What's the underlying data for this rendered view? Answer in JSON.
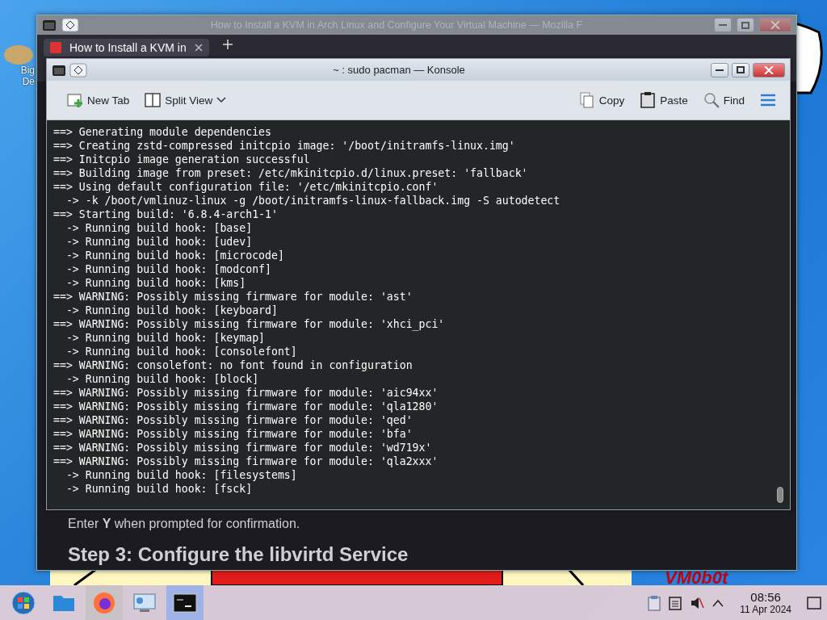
{
  "desktop": {
    "icon_label_lines": [
      "Big",
      "De"
    ],
    "wallpaper_texts": [
      "VM0b0t"
    ]
  },
  "browser_window": {
    "title": "How to Install a KVM in Arch Linux and Configure Your Virtual Machine — Mozilla F",
    "tabs": [
      {
        "label": "How to Install a KVM in",
        "selected": true
      }
    ],
    "paragraph": "Enter **Y** when prompted for confirmation.",
    "heading": "Step 3: Configure the libvirtd Service"
  },
  "konsole": {
    "title": "~ : sudo pacman — Konsole",
    "toolbar": [
      {
        "kind": "new-tab",
        "label": "New Tab"
      },
      {
        "kind": "split-view",
        "label": "Split View"
      },
      {
        "kind": "copy",
        "label": "Copy"
      },
      {
        "kind": "paste",
        "label": "Paste"
      },
      {
        "kind": "find",
        "label": "Find"
      },
      {
        "kind": "menu"
      }
    ],
    "lines": [
      "==> Generating module dependencies",
      "==> Creating zstd-compressed initcpio image: '/boot/initramfs-linux.img'",
      "==> Initcpio image generation successful",
      "==> Building image from preset: /etc/mkinitcpio.d/linux.preset: 'fallback'",
      "==> Using default configuration file: '/etc/mkinitcpio.conf'",
      "  -> -k /boot/vmlinuz-linux -g /boot/initramfs-linux-fallback.img -S autodetect",
      "==> Starting build: '6.8.4-arch1-1'",
      "  -> Running build hook: [base]",
      "  -> Running build hook: [udev]",
      "  -> Running build hook: [microcode]",
      "  -> Running build hook: [modconf]",
      "  -> Running build hook: [kms]",
      "==> WARNING: Possibly missing firmware for module: 'ast'",
      "  -> Running build hook: [keyboard]",
      "==> WARNING: Possibly missing firmware for module: 'xhci_pci'",
      "  -> Running build hook: [keymap]",
      "  -> Running build hook: [consolefont]",
      "==> WARNING: consolefont: no font found in configuration",
      "  -> Running build hook: [block]",
      "==> WARNING: Possibly missing firmware for module: 'aic94xx'",
      "==> WARNING: Possibly missing firmware for module: 'qla1280'",
      "==> WARNING: Possibly missing firmware for module: 'qed'",
      "==> WARNING: Possibly missing firmware for module: 'bfa'",
      "==> WARNING: Possibly missing firmware for module: 'wd719x'",
      "==> WARNING: Possibly missing firmware for module: 'qla2xxx'",
      "  -> Running build hook: [filesystems]",
      "  -> Running build hook: [fsck]"
    ]
  },
  "taskbar": {
    "apps": [
      {
        "kind": "start",
        "selected": false,
        "hovered": false
      },
      {
        "kind": "files",
        "selected": false,
        "hovered": false
      },
      {
        "kind": "browser",
        "selected": false,
        "hovered": true
      },
      {
        "kind": "settings",
        "selected": false,
        "hovered": false
      },
      {
        "kind": "terminal",
        "selected": true,
        "hovered": false
      }
    ],
    "clock": {
      "time": "08:56",
      "date": "11 Apr 2024"
    }
  }
}
